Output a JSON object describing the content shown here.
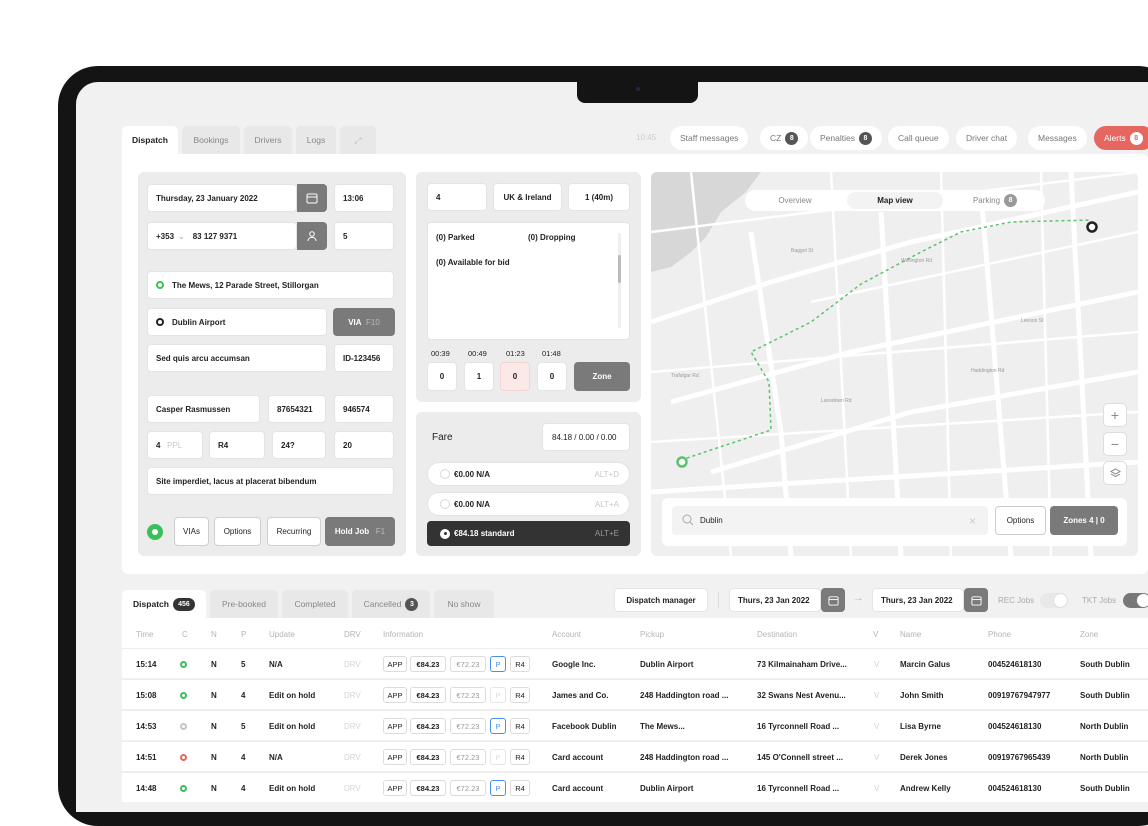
{
  "top_tabs": [
    "Dispatch",
    "Bookings",
    "Drivers",
    "Logs"
  ],
  "clock": "10:45",
  "top_pills": {
    "staff_messages": "Staff messages",
    "cz": "CZ",
    "cz_count": "8",
    "penalties": "Penalties",
    "penalties_count": "8",
    "call_queue": "Call queue",
    "driver_chat": "Driver chat",
    "messages": "Messages",
    "alerts": "Alerts",
    "alerts_count": "8"
  },
  "booking_form": {
    "date": "Thursday, 23 January 2022",
    "time": "13:06",
    "country_code": "+353",
    "phone": "83 127 9371",
    "passengers": "5",
    "pickup": "The Mews, 12 Parade Street, Stillorgan",
    "destination": "Dublin Airport",
    "via_label": "VIA",
    "via_key": "F10",
    "note": "Sed quis arcu accumsan",
    "id": "ID-123456",
    "customer_name": "Casper Rasmussen",
    "account_no": "87654321",
    "ref_no": "946574",
    "ppl_count": "4",
    "ppl_label": "PPL",
    "vehicle": "R4",
    "code": "24?",
    "qty": "20",
    "comment": "Site imperdiet, lacus at placerat bibendum",
    "buttons": {
      "vias": "VIAs",
      "options": "Options",
      "recurring": "Recurring",
      "hold_job": "Hold Job",
      "hold_key": "F1"
    }
  },
  "zone_panel": {
    "zone_num": "4",
    "region": "UK & Ireland",
    "eta": "1 (40m)",
    "parked": "(0) Parked",
    "dropping": "(0) Dropping",
    "available": "(0) Available for bid",
    "timers": [
      "00:39",
      "00:49",
      "01:23",
      "01:48"
    ],
    "counts": [
      "0",
      "1",
      "0",
      "0"
    ],
    "zone_button": "Zone"
  },
  "fare": {
    "label": "Fare",
    "value": "84.18 / 0.00 / 0.00",
    "options": [
      {
        "label": "€0.00 N/A",
        "key": "ALT+D"
      },
      {
        "label": "€0.00 N/A",
        "key": "ALT+A"
      },
      {
        "label": "€84.18 standard",
        "key": "ALT+E"
      }
    ]
  },
  "map": {
    "tabs": [
      "Overview",
      "Map view",
      "Parking"
    ],
    "parking_count": "8",
    "search_value": "Dublin",
    "options_label": "Options",
    "zones_label": "Zones 4 | 0",
    "streets": [
      "Trafalgar Rd",
      "Wellington Rd",
      "Lansdown Rd",
      "Haddington Rd",
      "Baggot St",
      "Leeson St"
    ]
  },
  "list": {
    "tabs": {
      "dispatch": "Dispatch",
      "dispatch_count": "456",
      "prebooked": "Pre-booked",
      "completed": "Completed",
      "cancelled": "Cancelled",
      "cancelled_count": "3",
      "no_show": "No show"
    },
    "dispatch_manager": "Dispatch manager",
    "date_from": "Thurs, 23 Jan 2022",
    "date_to": "Thurs, 23 Jan 2022",
    "rec_jobs": "REC Jobs",
    "tkt_jobs": "TKT Jobs",
    "columns": [
      "Time",
      "C",
      "N",
      "P",
      "Update",
      "DRV",
      "Information",
      "Account",
      "Pickup",
      "Destination",
      "V",
      "Name",
      "Phone",
      "Zone"
    ],
    "rows": [
      {
        "time": "15:14",
        "status": "green",
        "n": "N",
        "p": "5",
        "update": "N/A",
        "drv": "DRV",
        "app": "APP",
        "price1": "€84.23",
        "price2": "€72.23",
        "pflag": "P",
        "pactive": true,
        "veh": "R4",
        "account": "Google Inc.",
        "pickup": "Dublin Airport",
        "destination": "73 Kilmainaham Drive...",
        "v": "V",
        "name": "Marcin Galus",
        "phone": "004524618130",
        "zone": "South Dublin"
      },
      {
        "time": "15:08",
        "status": "green",
        "n": "N",
        "p": "4",
        "update": "Edit on hold",
        "drv": "DRV",
        "app": "APP",
        "price1": "€84.23",
        "price2": "€72.23",
        "pflag": "P",
        "pactive": false,
        "veh": "R4",
        "account": "James and Co.",
        "pickup": "248 Haddington road ...",
        "destination": "32 Swans Nest Avenu...",
        "v": "V",
        "name": "John Smith",
        "phone": "00919767947977",
        "zone": "South Dublin"
      },
      {
        "time": "14:53",
        "status": "grey",
        "n": "N",
        "p": "5",
        "update": "Edit on hold",
        "drv": "DRV",
        "app": "APP",
        "price1": "€84.23",
        "price2": "€72.23",
        "pflag": "P",
        "pactive": true,
        "veh": "R4",
        "account": "Facebook Dublin",
        "pickup": "The Mews...",
        "destination": "16 Tyrconnell Road ...",
        "v": "V",
        "name": "Lisa Byrne",
        "phone": "004524618130",
        "zone": "North Dublin"
      },
      {
        "time": "14:51",
        "status": "red",
        "n": "N",
        "p": "4",
        "update": "N/A",
        "drv": "DRV",
        "app": "APP",
        "price1": "€84.23",
        "price2": "€72.23",
        "pflag": "P",
        "pactive": false,
        "veh": "R4",
        "account": "Card account",
        "pickup": "248 Haddington road ...",
        "destination": "145 O'Connell street ...",
        "v": "V",
        "name": "Derek Jones",
        "phone": "00919767965439",
        "zone": "North Dublin"
      },
      {
        "time": "14:48",
        "status": "green",
        "n": "N",
        "p": "4",
        "update": "Edit on hold",
        "drv": "DRV",
        "app": "APP",
        "price1": "€84.23",
        "price2": "€72.23",
        "pflag": "P",
        "pactive": true,
        "veh": "R4",
        "account": "Card account",
        "pickup": "Dublin Airport",
        "destination": "16 Tyrconnell Road ...",
        "v": "V",
        "name": "Andrew Kelly",
        "phone": "004524618130",
        "zone": "South Dublin"
      }
    ]
  },
  "colors": {
    "accent_green": "#3bbf5a",
    "alert_red": "#e5675f",
    "dark_button": "#7a7a7a",
    "selected_fare": "#333333",
    "route": "#5cc16b"
  }
}
